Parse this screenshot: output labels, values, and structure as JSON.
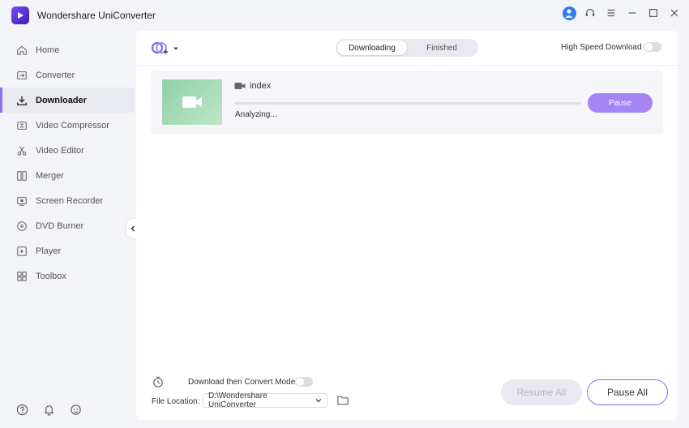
{
  "app": {
    "title": "Wondershare UniConverter"
  },
  "sidebar": {
    "items": [
      {
        "label": "Home",
        "icon": "home-icon"
      },
      {
        "label": "Converter",
        "icon": "converter-icon"
      },
      {
        "label": "Downloader",
        "icon": "downloader-icon"
      },
      {
        "label": "Video Compressor",
        "icon": "compress-icon"
      },
      {
        "label": "Video Editor",
        "icon": "scissors-icon"
      },
      {
        "label": "Merger",
        "icon": "merge-icon"
      },
      {
        "label": "Screen Recorder",
        "icon": "screen-record-icon"
      },
      {
        "label": "DVD Burner",
        "icon": "disc-icon"
      },
      {
        "label": "Player",
        "icon": "play-icon"
      },
      {
        "label": "Toolbox",
        "icon": "grid-icon"
      }
    ],
    "active": "Downloader"
  },
  "tabs": {
    "downloading": "Downloading",
    "finished": "Finished"
  },
  "high_speed": {
    "label": "High Speed Download",
    "enabled": false
  },
  "download": {
    "name": "index",
    "status": "Analyzing...",
    "progress": 0,
    "pause_label": "Pause"
  },
  "footer": {
    "convert_mode_label": "Download then Convert Mode",
    "convert_mode_enabled": false,
    "file_location_label": "File Location:",
    "file_location_value": "D:\\Wondershare UniConverter",
    "resume_all": "Resume All",
    "pause_all": "Pause All"
  },
  "colors": {
    "accent": "#8c6cf0",
    "pause_button": "#a584f5",
    "user": "#2f7cf6"
  }
}
